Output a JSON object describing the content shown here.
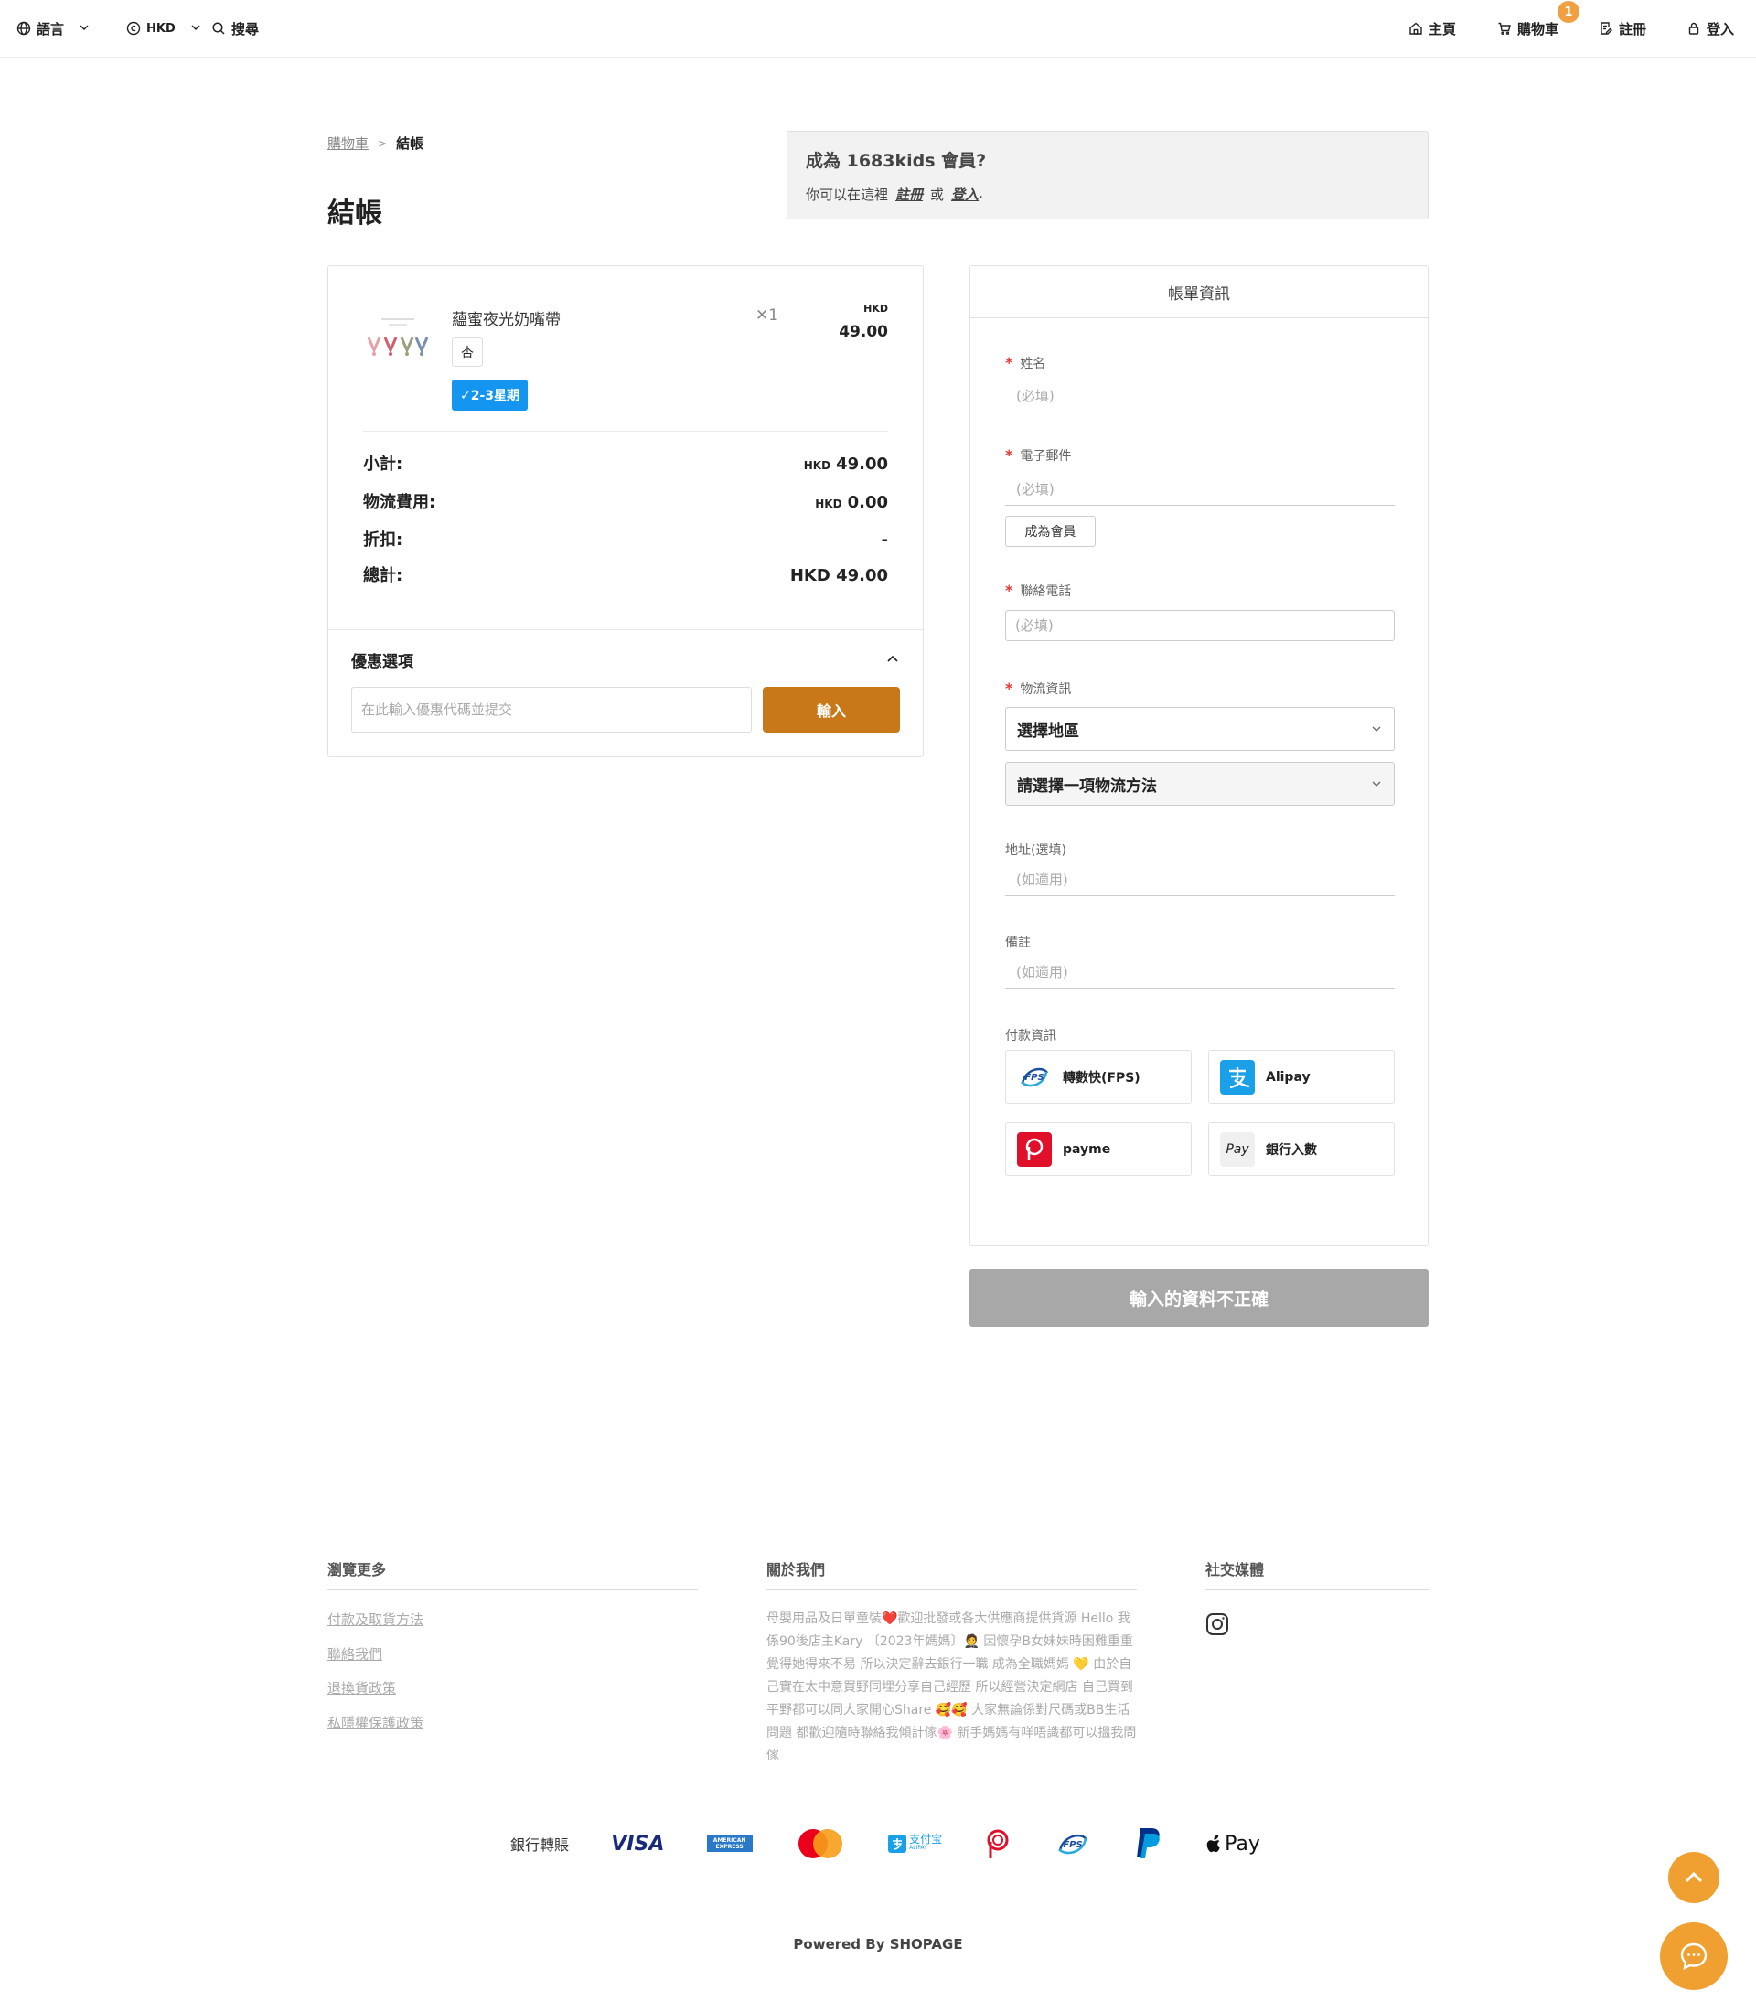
{
  "nav": {
    "language": "語言",
    "currency": "HKD",
    "search": "搜尋",
    "home": "主頁",
    "cart": "購物車",
    "cart_count": "1",
    "register": "註冊",
    "login": "登入"
  },
  "breadcrumb": {
    "cart": "購物車",
    "sep": ">",
    "current": "結帳"
  },
  "page_title": "結帳",
  "member": {
    "title": "成為 1683kids 會員?",
    "text_prefix": "你可以在這裡",
    "register_link": "註冊",
    "or": "或",
    "login_link": "登入",
    "dot": "."
  },
  "cart": {
    "item": {
      "name": "蘊蜜夜光奶嘴帶",
      "qty": "✕1",
      "currency": "HKD",
      "price": "49.00",
      "variant": "杏",
      "shipping_tag": "✓2-3星期"
    },
    "summary": {
      "subtotal_label": "小計:",
      "subtotal_cur": "HKD",
      "subtotal_value": "49.00",
      "shipping_label": "物流費用:",
      "shipping_cur": "HKD",
      "shipping_value": "0.00",
      "discount_label": "折扣:",
      "discount_value": "-",
      "total_label": "總計:",
      "total_value": "HKD 49.00"
    },
    "coupon": {
      "title": "優惠選項",
      "placeholder": "在此輸入優惠代碼並提交",
      "button": "輸入"
    }
  },
  "billing": {
    "title": "帳單資訊",
    "req_mark": "*",
    "name_label": "姓名",
    "name_placeholder": "(必填)",
    "email_label": "電子郵件",
    "email_placeholder": "(必填)",
    "member_button": "成為會員",
    "phone_label": "聯絡電話",
    "phone_placeholder": "(必填)",
    "logistics_label": "物流資訊",
    "region_select": "選擇地區",
    "method_select": "請選擇一項物流方法",
    "address_label": "地址(選填)",
    "address_placeholder": "(如適用)",
    "note_label": "備註",
    "note_placeholder": "(如適用)",
    "payment_label": "付款資訊",
    "payments": [
      "轉數快(FPS)",
      "Alipay",
      "payme",
      "銀行入數"
    ],
    "pay_icon_text": "Pay",
    "fps_icon_text": "FPS"
  },
  "submit_button": "輸入的資料不正確",
  "footer": {
    "browse_title": "瀏覽更多",
    "links": [
      "付款及取貨方法",
      "聯絡我們",
      "退換貨政策",
      "私隱權保護政策"
    ],
    "about_title": "關於我們",
    "about_text": "母嬰用品及日單童裝❤️歡迎批發或各大供應商提供貨源 Hello 我係90後店主Kary 〔2023年媽媽〕🤵 因懷孕B女妹妹時困難重重 覺得她得來不易 所以決定辭去銀行一職 成為全職媽媽 💛 由於自己實在太中意買野同埋分享自己經歷 所以經營決定網店 自己買到平野都可以同大家開心Share 🥰🥰 大家無論係對尺碼或BB生活問題 都歡迎隨時聯絡我傾計傢🌸 新手媽媽有咩唔識都可以搵我問傢",
    "social_title": "社交媒體",
    "pay_strip": {
      "bank": "銀行轉賬",
      "visa": "VISA",
      "amex": "AMERICAN EXPRESS",
      "alipay": "支付宝",
      "alipay_sub": "ALIPAY",
      "fps": "FPS",
      "applepay": "Pay"
    },
    "powered": "Powered By SHOPAGE"
  },
  "colors": {
    "accent": "#c87818",
    "badge": "#f0a040",
    "ship_tag": "#1496f0",
    "required": "#e53935",
    "disabled": "#a8a8a8"
  }
}
